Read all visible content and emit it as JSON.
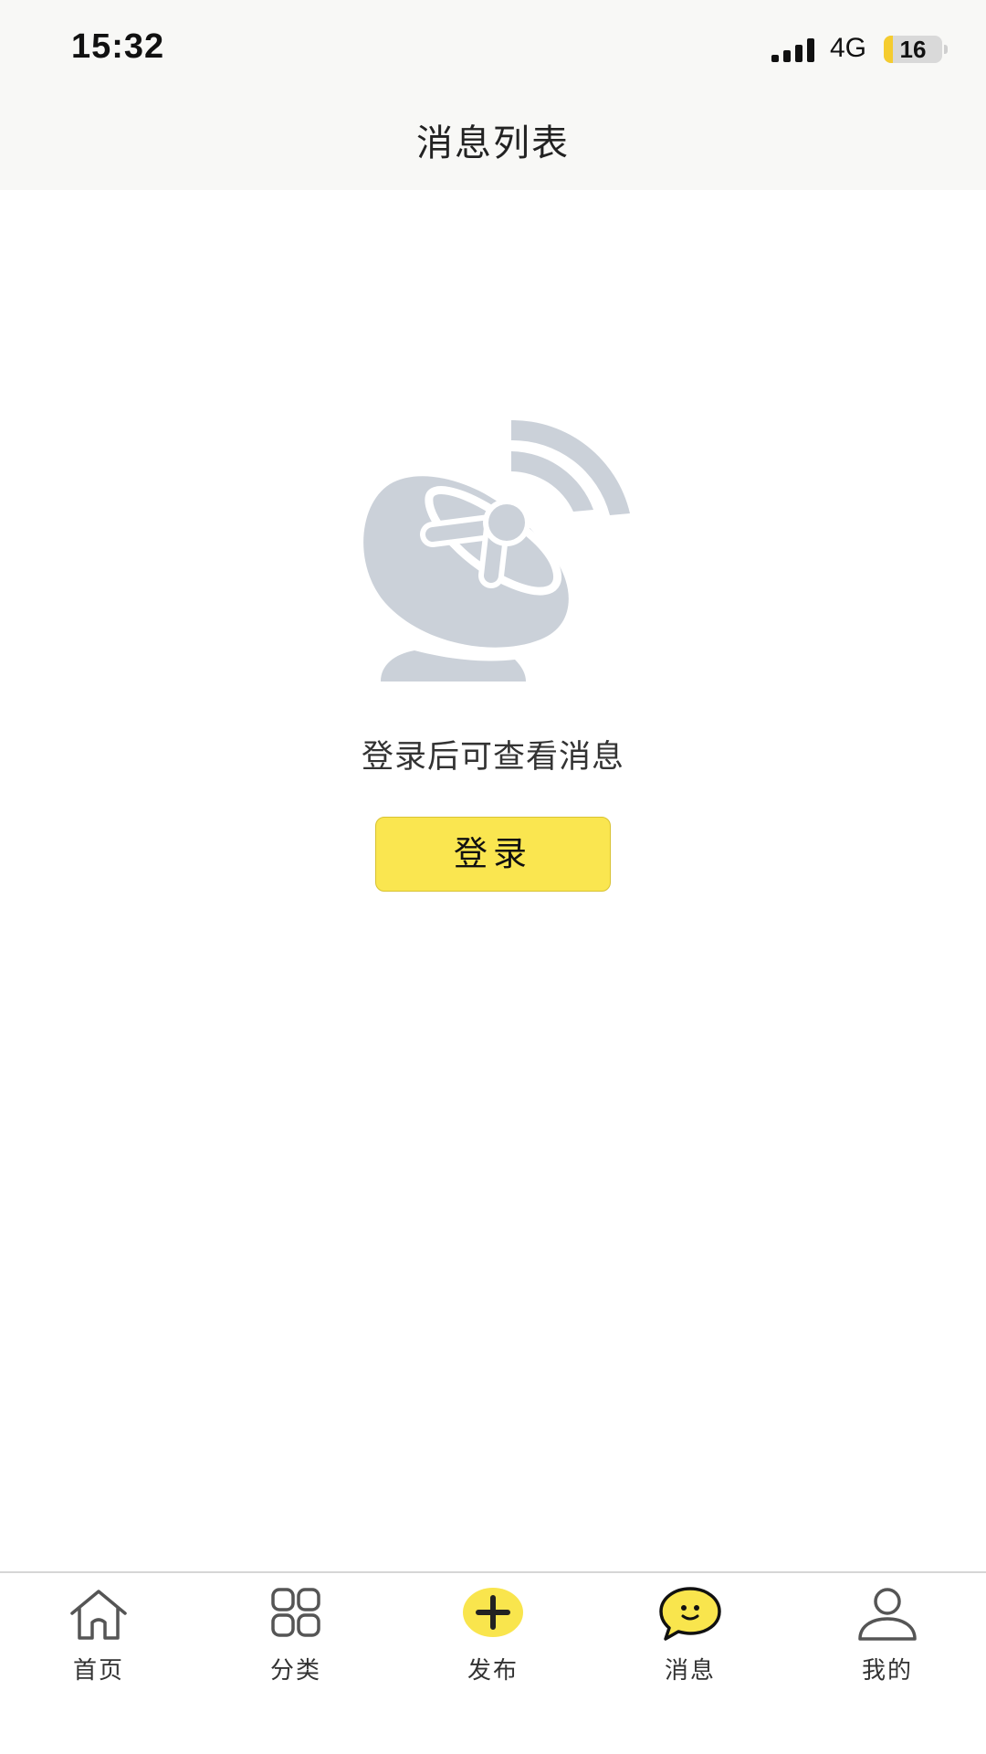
{
  "status_bar": {
    "time": "15:32",
    "network": "4G",
    "battery_level": "16",
    "battery_fraction": 0.16
  },
  "header": {
    "title": "消息列表"
  },
  "empty_state": {
    "icon": "satellite-dish-icon",
    "message": "登录后可查看消息",
    "login_button": "登录"
  },
  "tabbar": {
    "active_tab": "消息",
    "accent_color": "#f9e54d",
    "items": [
      {
        "label": "首页",
        "icon": "home-icon"
      },
      {
        "label": "分类",
        "icon": "grid-icon"
      },
      {
        "label": "发布",
        "icon": "plus-circle-icon"
      },
      {
        "label": "消息",
        "icon": "chat-bubble-icon"
      },
      {
        "label": "我的",
        "icon": "user-icon"
      }
    ]
  }
}
